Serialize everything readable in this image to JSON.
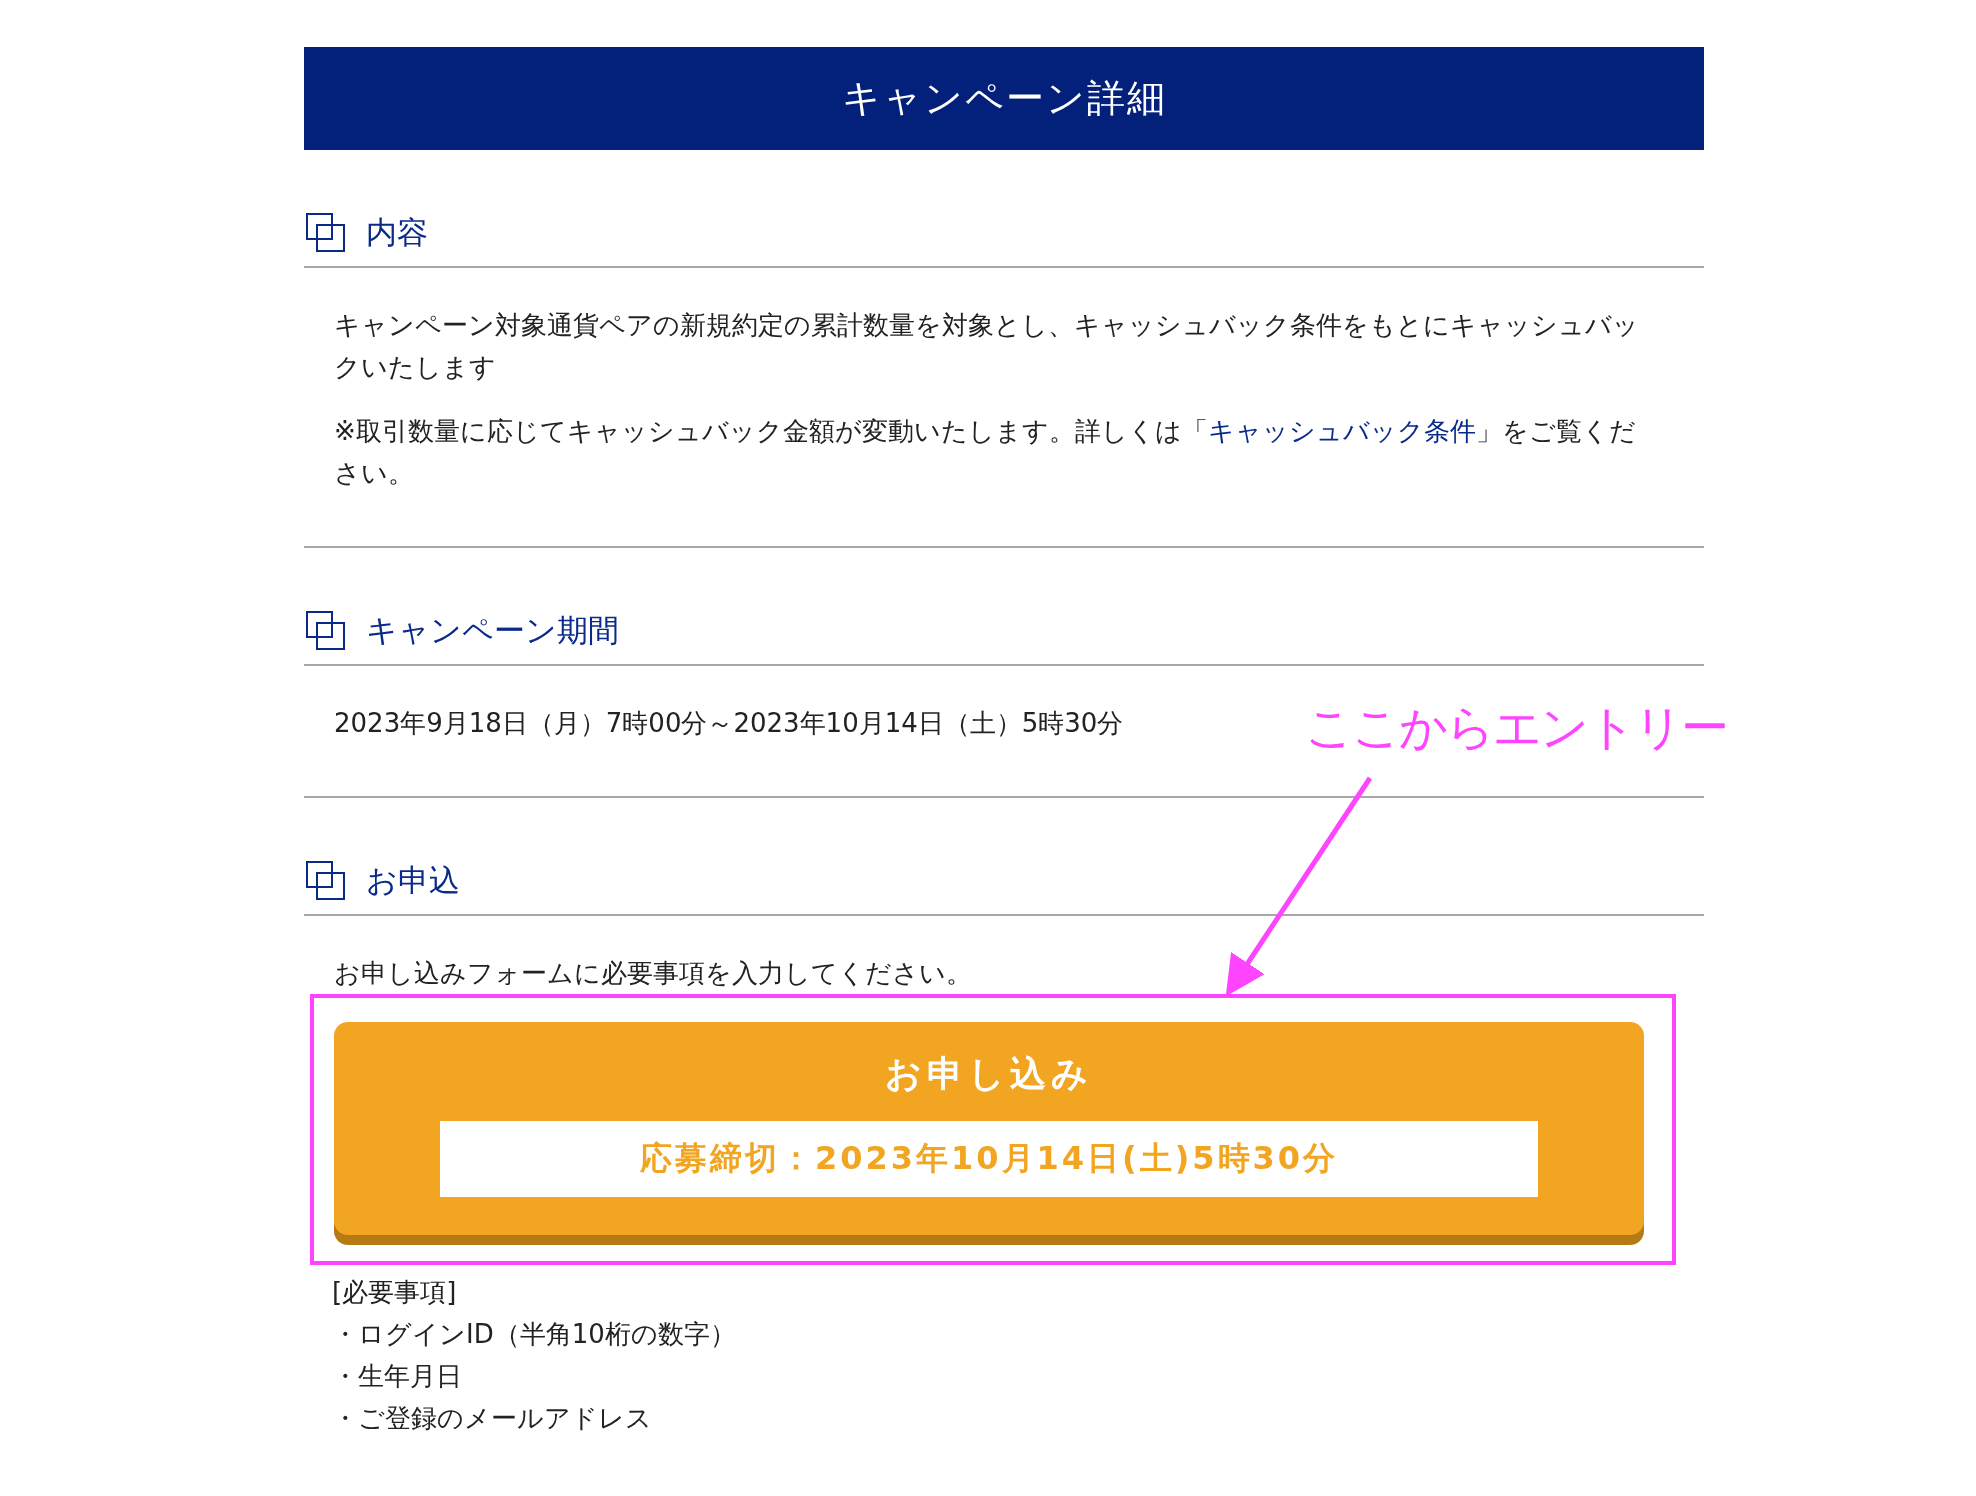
{
  "header": {
    "title": "キャンペーン詳細"
  },
  "sections": [
    {
      "title": "内容",
      "blocks": [
        {
          "kind": "text",
          "text": "キャンペーン対象通貨ペアの新規約定の累計数量を対象とし、キャッシュバック条件をもとにキャッシュバックいたします"
        },
        {
          "kind": "linked_text",
          "before": "※取引数量に応じてキャッシュバック金額が変動いたします。詳しくは「",
          "link": "キャッシュバック条件",
          "after": "」をご覧ください。"
        }
      ]
    },
    {
      "title": "キャンペーン期間",
      "blocks": [
        {
          "kind": "text",
          "text": "2023年9月18日（月）7時00分～2023年10月14日（土）5時30分"
        }
      ]
    },
    {
      "title": "お申込",
      "blocks": [
        {
          "kind": "text",
          "text": "お申し込みフォームに必要事項を入力してください。"
        },
        {
          "kind": "apply_button",
          "label": "お申し込み",
          "deadline": "応募締切：2023年10月14日(土)5時30分",
          "highlighted": true
        },
        {
          "kind": "requirements",
          "heading": "[必要事項]",
          "items": [
            "・ログインID（半角10桁の数字）",
            "・生年月日",
            "・ご登録のメールアドレス"
          ]
        }
      ]
    }
  ],
  "annotation": {
    "text": "ここからエントリー"
  }
}
